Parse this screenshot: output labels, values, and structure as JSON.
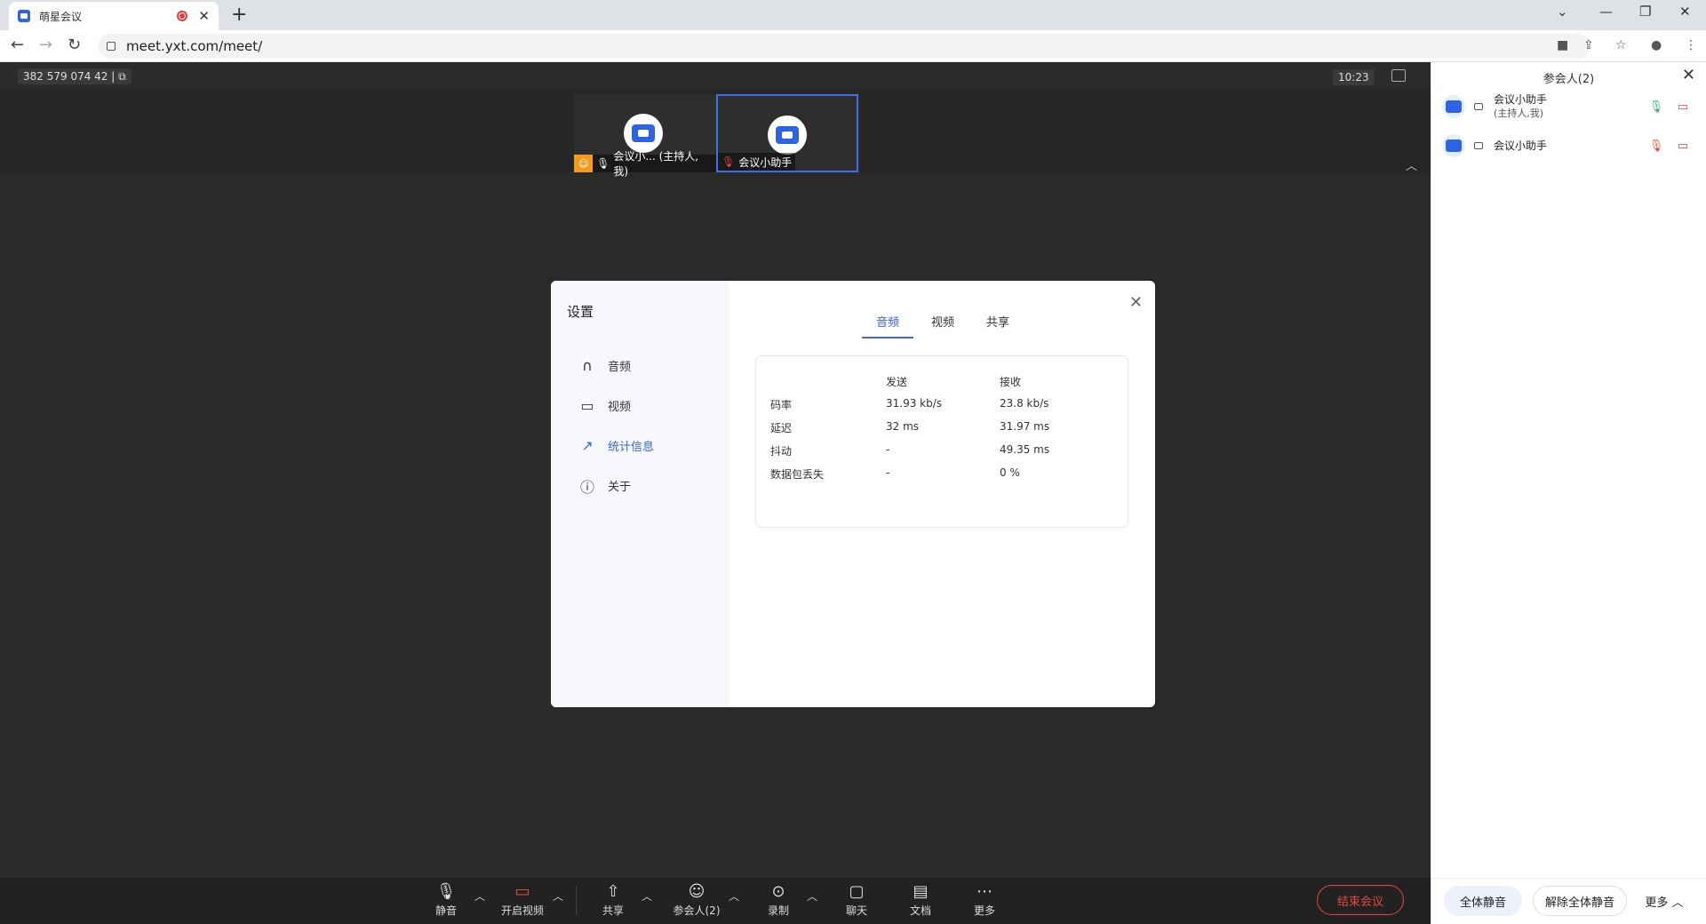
{
  "browser": {
    "tab_title": "萌星会议",
    "url": "meet.yxt.com/meet/"
  },
  "meeting": {
    "id": "382 579 074 42 |",
    "time": "10:23",
    "tiles": [
      {
        "label": "会议小... (主持人, 我)"
      },
      {
        "label": "会议小助手"
      }
    ]
  },
  "settings": {
    "title": "设置",
    "side_items": [
      "音频",
      "视频",
      "统计信息",
      "关于"
    ],
    "tabs": [
      "音频",
      "视频",
      "共享"
    ],
    "headers": [
      "发送",
      "接收"
    ],
    "rows": [
      {
        "label": "码率",
        "send": "31.93 kb/s",
        "recv": "23.8 kb/s"
      },
      {
        "label": "延迟",
        "send": "32 ms",
        "recv": "31.97 ms"
      },
      {
        "label": "抖动",
        "send": "-",
        "recv": "49.35 ms"
      },
      {
        "label": "数据包丢失",
        "send": "-",
        "recv": "0 %"
      }
    ]
  },
  "controls": {
    "mute": "静音",
    "video": "开启视频",
    "share": "共享",
    "participants": "参会人(2)",
    "record": "录制",
    "chat": "聊天",
    "docs": "文档",
    "more": "更多",
    "end": "结束会议"
  },
  "panel": {
    "title": "参会人(2)",
    "people": [
      {
        "name": "会议小助手",
        "role": "(主持人,我)"
      },
      {
        "name": "会议小助手",
        "role": ""
      }
    ],
    "mute_all": "全体静音",
    "unmute_all": "解除全体静音",
    "more": "更多"
  },
  "colors": {
    "accent": "#3a63e8",
    "danger": "#e5483f",
    "host_badge": "#f29b1d"
  }
}
